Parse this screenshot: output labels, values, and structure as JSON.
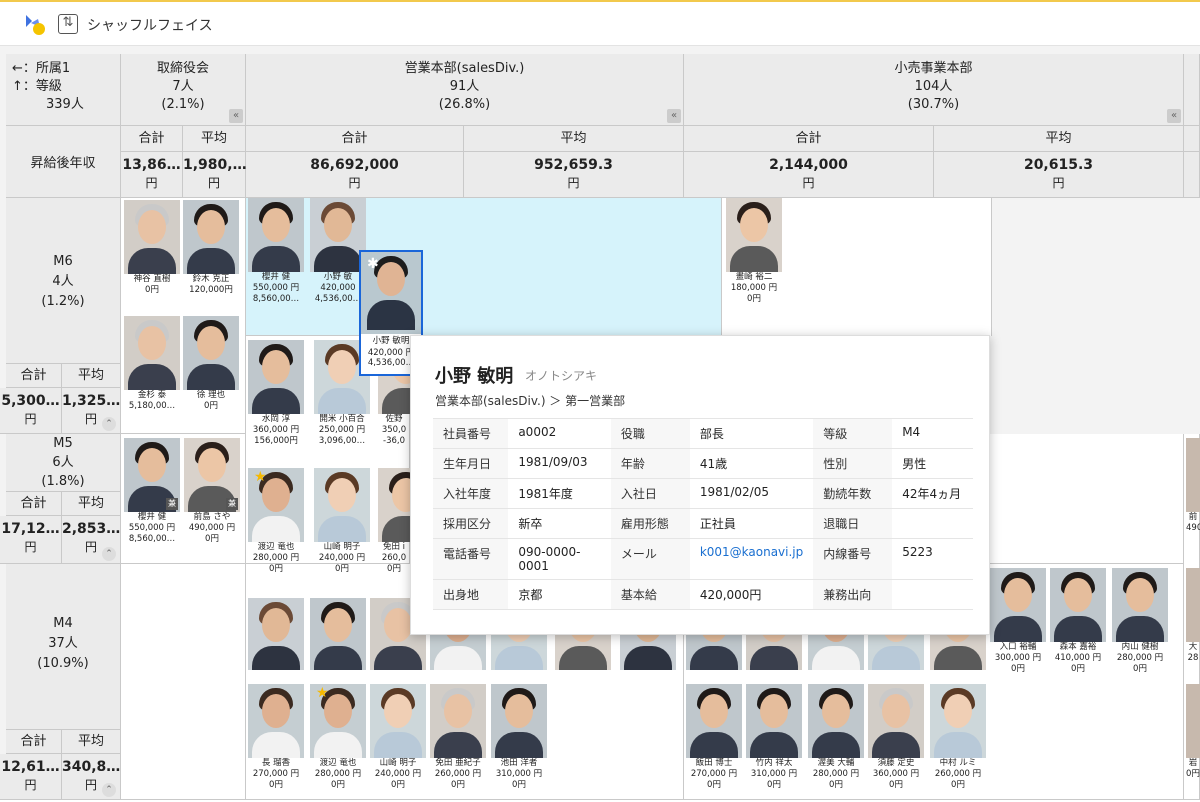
{
  "app": {
    "title": "シャッフルフェイス"
  },
  "corner": {
    "axis1": "←：所属1",
    "axis2": "↑：等級",
    "total": "339人"
  },
  "columns": [
    {
      "name": "取締役会",
      "count": "7人",
      "pct": "(2.1%)",
      "sum_label": "合計",
      "avg_label": "平均",
      "sum": "13,86…",
      "avg": "1,980,…",
      "unit": "円"
    },
    {
      "name": "営業本部(salesDiv.)",
      "count": "91人",
      "pct": "(26.8%)",
      "sum_label": "合計",
      "avg_label": "平均",
      "sum": "86,692,000",
      "avg": "952,659.3",
      "unit": "円"
    },
    {
      "name": "小売事業本部",
      "count": "104人",
      "pct": "(30.7%)",
      "sum_label": "合計",
      "avg_label": "平均",
      "sum": "2,144,000",
      "avg": "20,615.3",
      "unit": "円"
    }
  ],
  "metric_label": "昇給後年収",
  "rows": [
    {
      "grade": "M6",
      "count": "4人",
      "pct": "(1.2%)",
      "sum_label": "合計",
      "avg_label": "平均",
      "sum": "5,300…",
      "avg": "1,325…",
      "unit": "円"
    },
    {
      "grade": "M5",
      "count": "6人",
      "pct": "(1.8%)",
      "sum_label": "合計",
      "avg_label": "平均",
      "sum": "17,12…",
      "avg": "2,853…",
      "unit": "円"
    },
    {
      "grade": "M4",
      "count": "37人",
      "pct": "(10.9%)",
      "sum_label": "合計",
      "avg_label": "平均",
      "sum": "12,61…",
      "avg": "340,8…",
      "unit": "円"
    }
  ],
  "cards": {
    "m6_board": [
      {
        "name": "神谷 直樹",
        "v1": "",
        "v2": "0円"
      },
      {
        "name": "鈴木 克正",
        "v1": "",
        "v2": "120,000円"
      },
      {
        "name": "金杉 泰",
        "v1": "",
        "v2": "5,180,00…"
      },
      {
        "name": "徐 理也",
        "v1": "",
        "v2": "0円"
      }
    ],
    "m6_sales": [
      {
        "name": "櫻井 健",
        "v1": "550,000 円",
        "v2": "8,560,00…"
      },
      {
        "name": "小野 敏",
        "v1": "420,000",
        "v2": "4,536,00…"
      }
    ],
    "m6_sales_selected": {
      "name": "小野 敏明",
      "v1": "420,000 円",
      "v2": "4,536,00…"
    },
    "m6_retail": [
      {
        "name": "畫崎 裕二",
        "v1": "180,000 円",
        "v2": "0円"
      }
    ],
    "m5_board": [
      {
        "name": "櫻井 健",
        "v1": "550,000 円",
        "v2": "8,560,00…"
      },
      {
        "name": "前島 さや",
        "v1": "490,000 円",
        "v2": "0円"
      }
    ],
    "m5_sales_top": [
      {
        "name": "水岡 淳",
        "v1": "360,000 円",
        "v2": "156,000円"
      },
      {
        "name": "開米 小百合",
        "v1": "250,000 円",
        "v2": "3,096,00…"
      },
      {
        "name": "佐野",
        "v1": "350,0",
        "v2": "-36,0"
      }
    ],
    "m5_sales_bottom": [
      {
        "name": "渡辺 竜也",
        "v1": "280,000 円",
        "v2": "0円"
      },
      {
        "name": "山崎 明子",
        "v1": "240,000 円",
        "v2": "0円"
      },
      {
        "name": "免田 i",
        "v1": "260,0",
        "v2": "0円"
      }
    ],
    "m4_sales_bottom": [
      {
        "name": "長 瑠香",
        "v1": "270,000 円",
        "v2": "0円"
      },
      {
        "name": "渡辺 竜也",
        "v1": "280,000 円",
        "v2": "0円"
      },
      {
        "name": "山崎 明子",
        "v1": "240,000 円",
        "v2": "0円"
      },
      {
        "name": "免田 亜紀子",
        "v1": "260,000 円",
        "v2": "0円"
      },
      {
        "name": "池田 洋者",
        "v1": "310,000 円",
        "v2": "0円"
      }
    ],
    "m4_retail_top": [
      {
        "name": "入口 裕輔",
        "v1": "300,000 円",
        "v2": "0円"
      },
      {
        "name": "森本 嘉裕",
        "v1": "410,000 円",
        "v2": "0円"
      },
      {
        "name": "内山 健樹",
        "v1": "280,000 円",
        "v2": "0円"
      }
    ],
    "m4_retail_bottom": [
      {
        "name": "飯田 博士",
        "v1": "270,000 円",
        "v2": "0円"
      },
      {
        "name": "竹内 祥太",
        "v1": "310,000 円",
        "v2": "0円"
      },
      {
        "name": "渥美 大輔",
        "v1": "280,000 円",
        "v2": "0円"
      },
      {
        "name": "須藤 定史",
        "v1": "360,000 円",
        "v2": "0円"
      },
      {
        "name": "中村 ルミ",
        "v1": "260,000 円",
        "v2": "0円"
      }
    ],
    "edge": [
      {
        "name": "前",
        "v1": "490"
      },
      {
        "name": "大",
        "v1": "28"
      },
      {
        "name": "岩",
        "v1": "0円"
      }
    ]
  },
  "popup": {
    "name": "小野 敏明",
    "kana": "オノトシアキ",
    "dept": "営業本部(salesDiv.) ＞ 第一営業部",
    "rows": [
      [
        "社員番号",
        "a0002",
        "役職",
        "部長",
        "等級",
        "M4"
      ],
      [
        "生年月日",
        "1981/09/03",
        "年齢",
        "41歳",
        "性別",
        "男性"
      ],
      [
        "入社年度",
        "1981年度",
        "入社日",
        "1981/02/05",
        "勤続年数",
        "42年4ヵ月"
      ],
      [
        "採用区分",
        "新卒",
        "雇用形態",
        "正社員",
        "退職日",
        ""
      ],
      [
        "電話番号",
        "090-0000-0001",
        "メール",
        "k001@kaonavi.jp",
        "内線番号",
        "5223"
      ],
      [
        "出身地",
        "京都",
        "基本給",
        "420,000円",
        "兼務出向",
        ""
      ]
    ]
  },
  "colors": {
    "accent": "#1a66d9",
    "highlight": "#d6f3fb",
    "link": "#1a6fd0"
  }
}
